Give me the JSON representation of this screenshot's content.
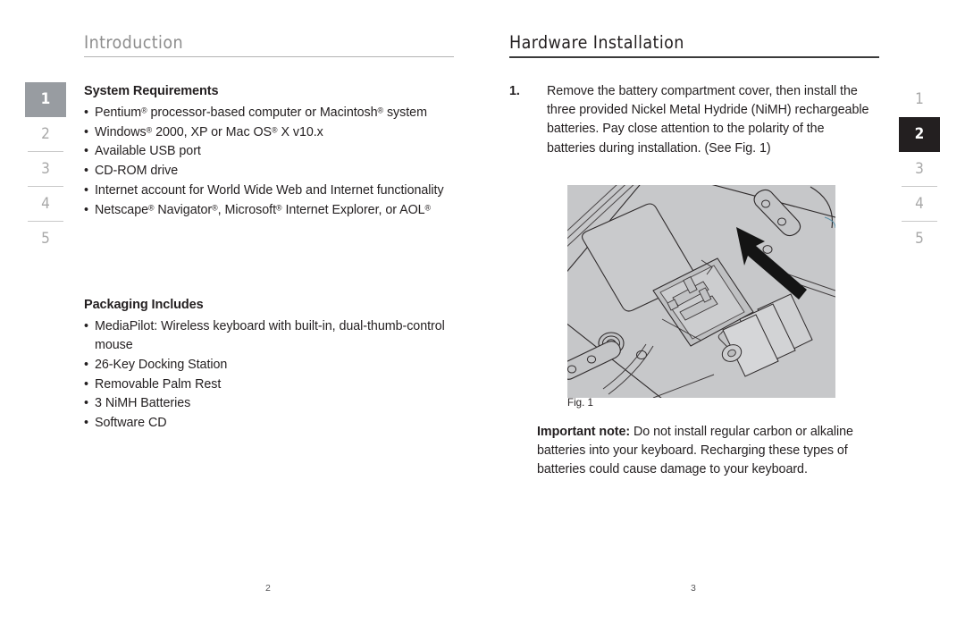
{
  "left_page": {
    "heading": "Introduction",
    "heading_color": "#8d8d8d",
    "rule_color": "#b4b4b4",
    "sections": [
      {
        "title": "System Requirements",
        "items": [
          "Pentium® processor-based computer or Macintosh® system",
          "Windows® 2000, XP or Mac OS® X v10.x",
          "Available USB port",
          "CD-ROM drive",
          "Internet account for World Wide Web and Internet functionality",
          "Netscape® Navigator®, Microsoft® Internet Explorer, or AOL®"
        ]
      },
      {
        "title": "Packaging Includes",
        "items": [
          "MediaPilot: Wireless keyboard with built-in, dual-thumb-control mouse",
          "26-Key Docking Station",
          "Removable Palm Rest",
          "3 NiMH Batteries",
          "Software CD"
        ]
      }
    ],
    "folio": "2",
    "tabs": [
      {
        "label": "1",
        "active": true,
        "style": "grey"
      },
      {
        "label": "2",
        "active": false,
        "style": ""
      },
      {
        "label": "3",
        "active": false,
        "style": ""
      },
      {
        "label": "4",
        "active": false,
        "style": ""
      },
      {
        "label": "5",
        "active": false,
        "style": ""
      }
    ]
  },
  "right_page": {
    "heading": "Hardware Installation",
    "heading_color": "#231f20",
    "rule_color": "#3a3a3a",
    "step": {
      "number": "1.",
      "text": "Remove the battery compartment cover, then install the three provided Nickel Metal Hydride (NiMH) rechargeable batteries. Pay close attention to the polarity of the batteries during installation. (See Fig. 1)"
    },
    "figure": {
      "caption": "Fig. 1",
      "alt_name": "keyboard-underside-battery-compartment-illustration",
      "background_color": "#c6c7c9",
      "line_color": "#231f20",
      "arrow_color": "#141414",
      "battery_count": 3
    },
    "note": {
      "label": "Important note:",
      "text": " Do not install regular carbon or alkaline batteries into your keyboard. Recharging these types of batteries could cause damage to your keyboard."
    },
    "folio": "3",
    "tabs": [
      {
        "label": "1",
        "active": false,
        "style": ""
      },
      {
        "label": "2",
        "active": true,
        "style": "dark"
      },
      {
        "label": "3",
        "active": false,
        "style": ""
      },
      {
        "label": "4",
        "active": false,
        "style": ""
      },
      {
        "label": "5",
        "active": false,
        "style": ""
      }
    ]
  }
}
